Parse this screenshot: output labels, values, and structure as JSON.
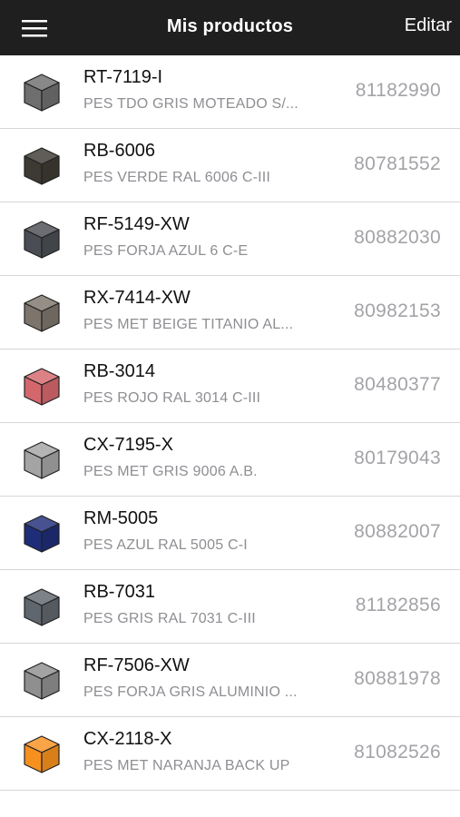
{
  "header": {
    "title": "Mis productos",
    "edit_label": "Editar"
  },
  "products": [
    {
      "code": "RT-7119-I",
      "description": "PES TDO GRIS MOTEADO S/...",
      "ref": "81182990",
      "color": "#6e6e6e"
    },
    {
      "code": "RB-6006",
      "description": "PES VERDE RAL 6006 C-III",
      "ref": "80781552",
      "color": "#3d3a33"
    },
    {
      "code": "RF-5149-XW",
      "description": "PES FORJA AZUL 6 C-E",
      "ref": "80882030",
      "color": "#4a4d53"
    },
    {
      "code": "RX-7414-XW",
      "description": "PES MET BEIGE TITANIO AL...",
      "ref": "80982153",
      "color": "#7d756c"
    },
    {
      "code": "RB-3014",
      "description": "PES ROJO RAL 3014 C-III",
      "ref": "80480377",
      "color": "#d4676c"
    },
    {
      "code": "CX-7195-X",
      "description": "PES MET GRIS 9006 A.B.",
      "ref": "80179043",
      "color": "#a4a4a4"
    },
    {
      "code": "RM-5005",
      "description": "PES AZUL RAL 5005 C-I",
      "ref": "80882007",
      "color": "#1d2d78"
    },
    {
      "code": "RB-7031",
      "description": "PES GRIS RAL 7031 C-III",
      "ref": "81182856",
      "color": "#5f666d"
    },
    {
      "code": "RF-7506-XW",
      "description": "PES FORJA GRIS ALUMINIO ...",
      "ref": "80881978",
      "color": "#8f8f8f"
    },
    {
      "code": "CX-2118-X",
      "description": "PES MET NARANJA BACK UP",
      "ref": "81082526",
      "color": "#f6901e"
    }
  ]
}
